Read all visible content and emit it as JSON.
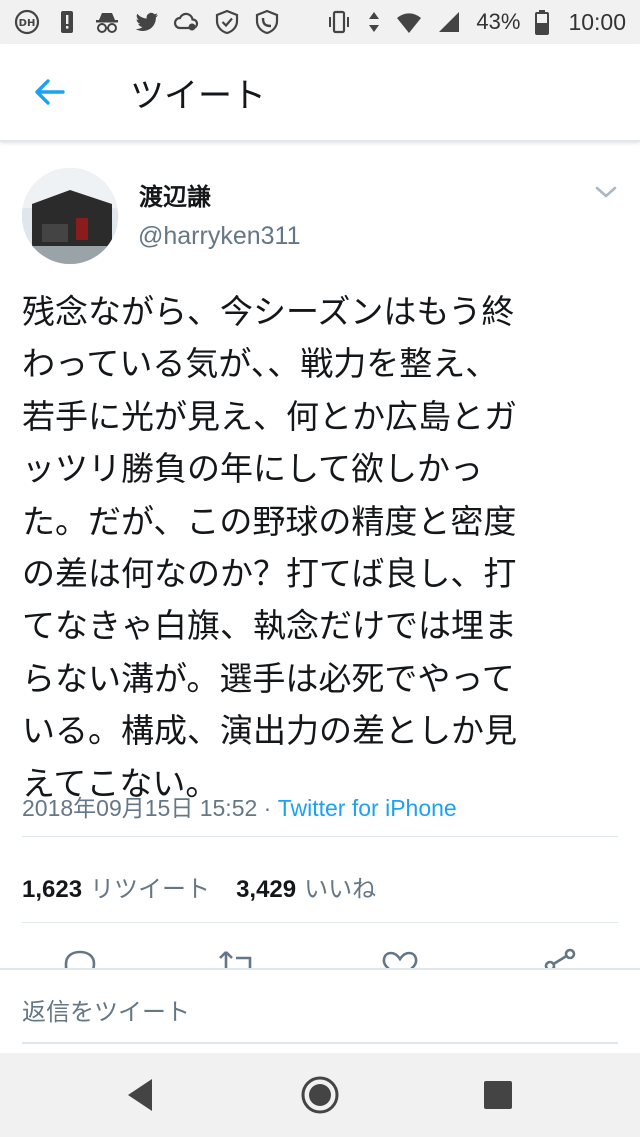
{
  "status_bar": {
    "left_icons": [
      "disney-hotstar-icon",
      "alert-icon",
      "spy-icon",
      "twitter-icon",
      "cloud-settings-icon",
      "shield-icon",
      "phone-settings-icon"
    ],
    "right_icons": [
      "vibrate-icon",
      "data-arrows-icon",
      "wifi-icon",
      "signal-icon",
      "battery-icon"
    ],
    "battery": "43%",
    "time": "10:00"
  },
  "header": {
    "title": "ツイート"
  },
  "tweet": {
    "display_name": "渡辺謙",
    "handle": "@harryken311",
    "lines": [
      "残念ながら、今シーズンはもう終",
      "わっている気が、、戦力を整え、",
      "若手に光が見え、何とか広島とガ",
      "ッツリ勝負の年にして欲しかっ",
      "た。だが、この野球の精度と密度",
      "の差は何なのか？打てば良し、打",
      "てなきゃ白旗、執念だけでは埋ま",
      "らない溝が。選手は必死でやって",
      "いる。構成、演出力の差としか見",
      "えてこない。"
    ],
    "timestamp": "2018年09月15日 15:52",
    "separator": "·",
    "source": "Twitter for iPhone",
    "retweet_count": "1,623",
    "retweet_label": "リツイート",
    "like_count": "3,429",
    "like_label": "いいね"
  },
  "reply": {
    "placeholder": "返信をツイート"
  },
  "colors": {
    "accent": "#1da1f2",
    "secondary_text": "#657786",
    "divider": "#e1e8ed"
  }
}
